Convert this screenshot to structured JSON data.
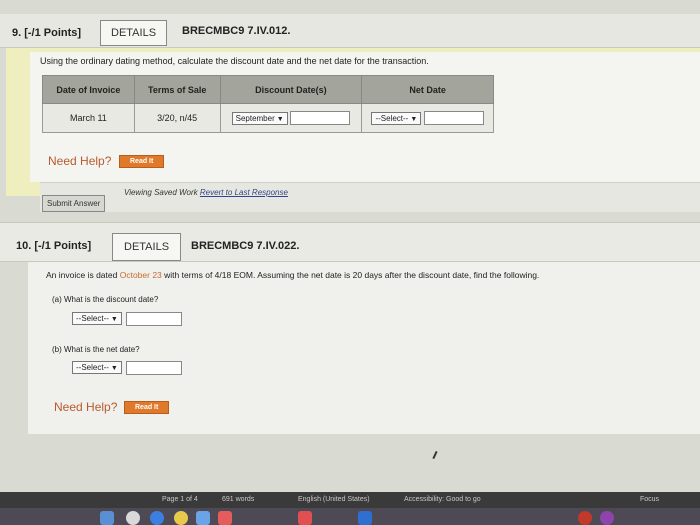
{
  "q9": {
    "number": "9. [-/1 Points]",
    "details": "DETAILS",
    "code": "BRECMBC9 7.IV.012.",
    "instructions": "Using the ordinary dating method, calculate the discount date and the net date for the transaction.",
    "columns": [
      "Date of Invoice",
      "Terms of Sale",
      "Discount Date(s)",
      "Net Date"
    ],
    "row": {
      "invoice_date": "March 11",
      "terms": "3/20, n/45",
      "discount_select": "September",
      "net_select": "--Select--"
    },
    "need_help": "Need Help?",
    "read_it": "Read It",
    "submit": "Submit Answer",
    "viewing_prefix": "Viewing Saved Work ",
    "revert_link": "Revert to Last Response"
  },
  "q10": {
    "number": "10. [-/1 Points]",
    "details": "DETAILS",
    "code": "BRECMBC9 7.IV.022.",
    "statement_a": "An invoice is dated ",
    "statement_date": "October 23",
    "statement_b": " with terms of 4/18 EOM. Assuming the net date is 20 days after the discount date, find the following.",
    "part_a": "(a)   What is the discount date?",
    "part_b": "(b)   What is the net date?",
    "select_a": "--Select--",
    "select_b": "--Select--",
    "need_help": "Need Help?",
    "read_it": "Read It"
  },
  "statusbar": {
    "page": "Page 1 of 4",
    "words": "691 words",
    "language": "English (United States)",
    "accessibility": "Accessibility: Good to go",
    "focus": "Focus"
  },
  "colors": {
    "panel_yellow": "#efeebe",
    "table_header": "#a3a49c",
    "read_button": "#e07a2a",
    "need_help": "#b85a2e"
  }
}
